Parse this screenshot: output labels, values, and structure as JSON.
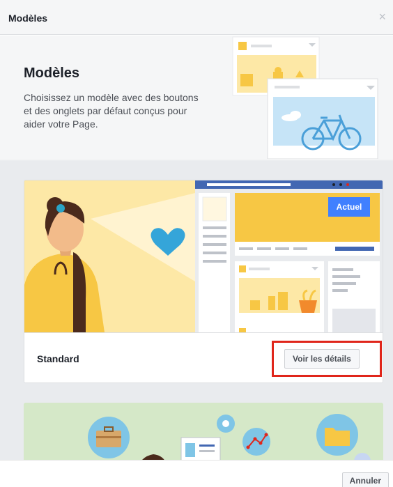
{
  "header": {
    "title": "Modèles",
    "close_icon": "close-icon"
  },
  "hero": {
    "title": "Modèles",
    "description": "Choisissez un modèle avec des boutons et des onglets par défaut conçus pour aider votre Page."
  },
  "templates": [
    {
      "name": "Standard",
      "badge": "Actuel",
      "details_label": "Voir les détails",
      "highlighted": true
    }
  ],
  "footer": {
    "cancel_label": "Annuler"
  },
  "colors": {
    "accent": "#4080ff",
    "highlight": "#e0261b",
    "illustration_yellow": "#f7c744",
    "illustration_pale": "#fde8a6",
    "card2_bg": "#d5e8c8"
  }
}
